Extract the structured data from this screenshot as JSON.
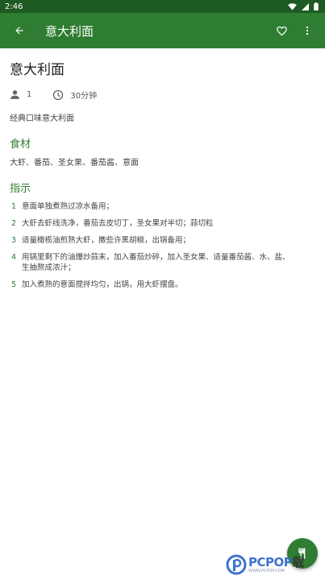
{
  "status_bar": {
    "time": "2:46"
  },
  "app_bar": {
    "title": "意大利面"
  },
  "recipe": {
    "title": "意大利面",
    "servings": "1",
    "time": "30分钟",
    "description": "经典口味意大利面"
  },
  "ingredients": {
    "heading": "食材",
    "text": "大虾、番茄、圣女果、番茄酱、意面"
  },
  "instructions": {
    "heading": "指示",
    "steps": [
      {
        "num": "1",
        "text": "意面单独煮熟过凉水备用；"
      },
      {
        "num": "2",
        "text": "大虾去虾线洗净，番茄去皮切丁，圣女果对半切；蒜切粒"
      },
      {
        "num": "3",
        "text": "适量橄榄油煎熟大虾，撒些许黑胡椒，出锅备用；"
      },
      {
        "num": "4",
        "text": "用锅里剩下的油爆炒蒜末，加入番茄炒碎，加入圣女果、适量番茄酱、水、盐、生抽熬成浓汁；"
      },
      {
        "num": "5",
        "text": "加入煮熟的意面搅拌均匀，出锅，用大虾摆盘。"
      }
    ]
  },
  "watermark": {
    "main": "PCPOP",
    "suffix": "载",
    "sub": "WWW.PCPOP.COM"
  },
  "colors": {
    "primary": "#2e7d32",
    "status_bar": "#1e5a24"
  },
  "icons": [
    "back-arrow-icon",
    "heart-outline-icon",
    "more-vert-icon",
    "person-icon",
    "clock-icon",
    "utensils-icon",
    "wifi-icon",
    "signal-icon",
    "battery-icon"
  ]
}
